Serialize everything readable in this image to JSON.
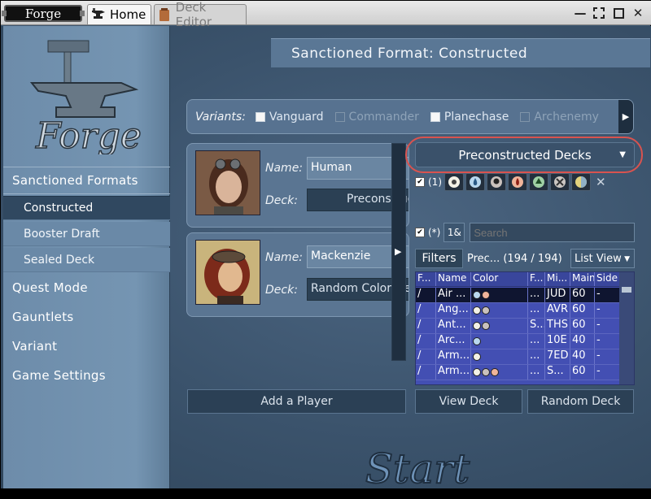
{
  "app": {
    "badge": "Forge"
  },
  "tabs": [
    {
      "label": "Home",
      "icon": "anvil-icon",
      "active": true
    },
    {
      "label": "Deck Editor",
      "icon": "deck-box-icon",
      "active": false
    }
  ],
  "window_controls": [
    "minimize-icon",
    "fullscreen-icon",
    "maximize-icon",
    "close-icon"
  ],
  "sidebar": {
    "logo_text": "Forge",
    "sections": [
      {
        "label": "Sanctioned Formats",
        "items": [
          "Constructed",
          "Booster Draft",
          "Sealed Deck"
        ],
        "selected": "Constructed"
      },
      {
        "label": "Quest Mode"
      },
      {
        "label": "Gauntlets"
      },
      {
        "label": "Variant"
      },
      {
        "label": "Game Settings"
      }
    ]
  },
  "header": {
    "title": "Sanctioned Format: Constructed"
  },
  "variants": {
    "label": "Variants:",
    "options": [
      {
        "label": "Vanguard",
        "enabled": true
      },
      {
        "label": "Commander",
        "enabled": false
      },
      {
        "label": "Planechase",
        "enabled": true
      },
      {
        "label": "Archenemy",
        "enabled": false
      }
    ]
  },
  "players": [
    {
      "name_label": "Name:",
      "name": "Human",
      "deck_label": "Deck:",
      "deck": "Preconstructed Deck"
    },
    {
      "name_label": "Name:",
      "name": "Mackenzie",
      "deck_label": "Deck:",
      "deck": "Random Color Deck"
    }
  ],
  "deck_chooser": {
    "selected": "Preconstructed Decks",
    "color_filter": {
      "count": "(1)",
      "mana": [
        "white",
        "blue",
        "black",
        "red",
        "green",
        "colorless",
        "multicolor"
      ]
    },
    "search": {
      "star": "(*)",
      "button": "1&",
      "placeholder": "Search"
    },
    "filters_label": "Filters",
    "filter_info": "Prec... (194 / 194)",
    "view": "List View",
    "columns": [
      "F...",
      "Name",
      "Color",
      "F...",
      "Mi...",
      "Main",
      "Side"
    ],
    "rows": [
      [
        "/",
        "Air ...",
        "UR",
        "...",
        "JUD",
        "60",
        "-"
      ],
      [
        "/",
        "Ang...",
        "WB",
        "...",
        "AVR",
        "60",
        "-"
      ],
      [
        "/",
        "Ant...",
        "WB",
        "S...",
        "THS",
        "60",
        "-"
      ],
      [
        "/",
        "Arc...",
        "U",
        "...",
        "10E",
        "40",
        "-"
      ],
      [
        "/",
        "Arm...",
        "W",
        "...",
        "7ED",
        "40",
        "-"
      ],
      [
        "/",
        "Arm...",
        "WBR",
        "...",
        "S...",
        "60",
        "-"
      ]
    ]
  },
  "buttons": {
    "add_player": "Add a Player",
    "view_deck": "View Deck",
    "random_deck": "Random Deck"
  },
  "start": {
    "label": "Start"
  },
  "colors": {
    "accent": "#3f5871",
    "highlight": "#d9534f",
    "table_bg": "#434fb3"
  }
}
